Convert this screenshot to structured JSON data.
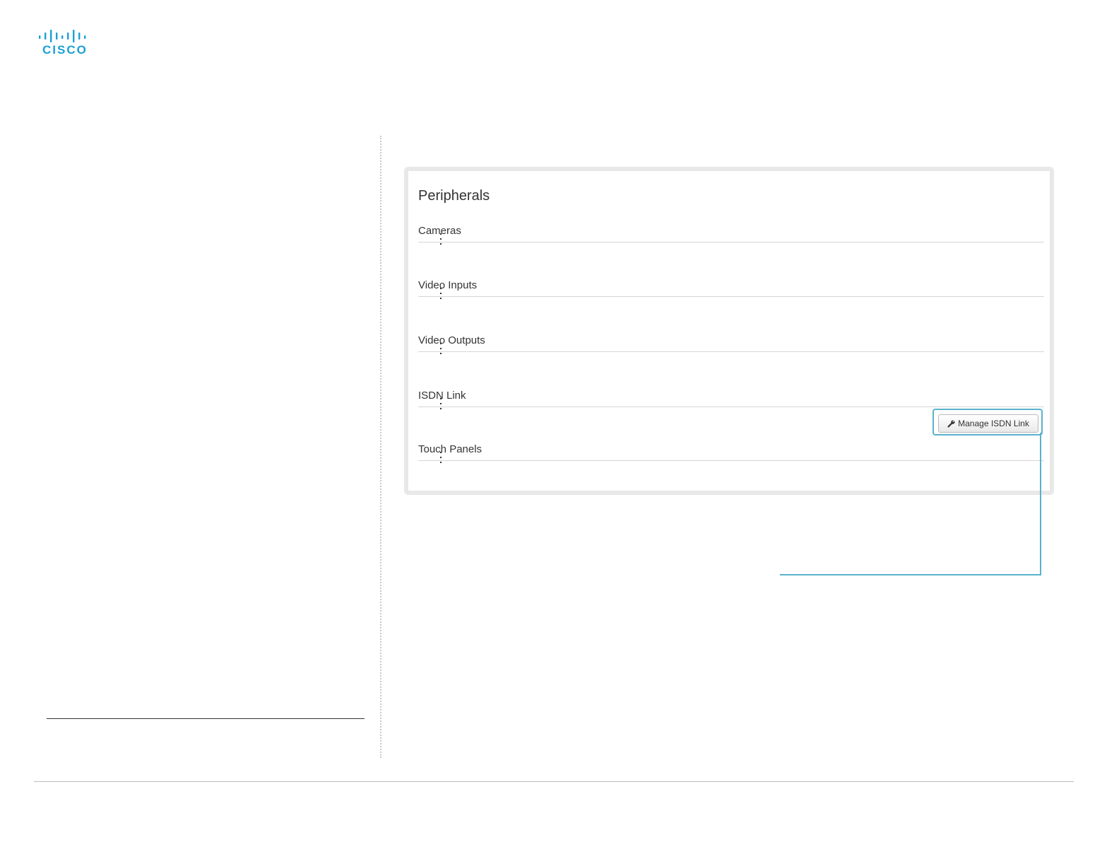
{
  "logo": {
    "text": "CISCO",
    "color": "#1ba0d7"
  },
  "panel": {
    "title": "Peripherals",
    "sections": [
      {
        "label": "Cameras"
      },
      {
        "label": "Video Inputs"
      },
      {
        "label": "Video Outputs"
      },
      {
        "label": "ISDN Link"
      },
      {
        "label": "Touch Panels"
      }
    ]
  },
  "isdn": {
    "button_label": "Manage ISDN Link",
    "button_icon": "wrench-icon"
  },
  "colors": {
    "callout": "#5ab2cc",
    "panel_border": "#e8e8e8"
  }
}
